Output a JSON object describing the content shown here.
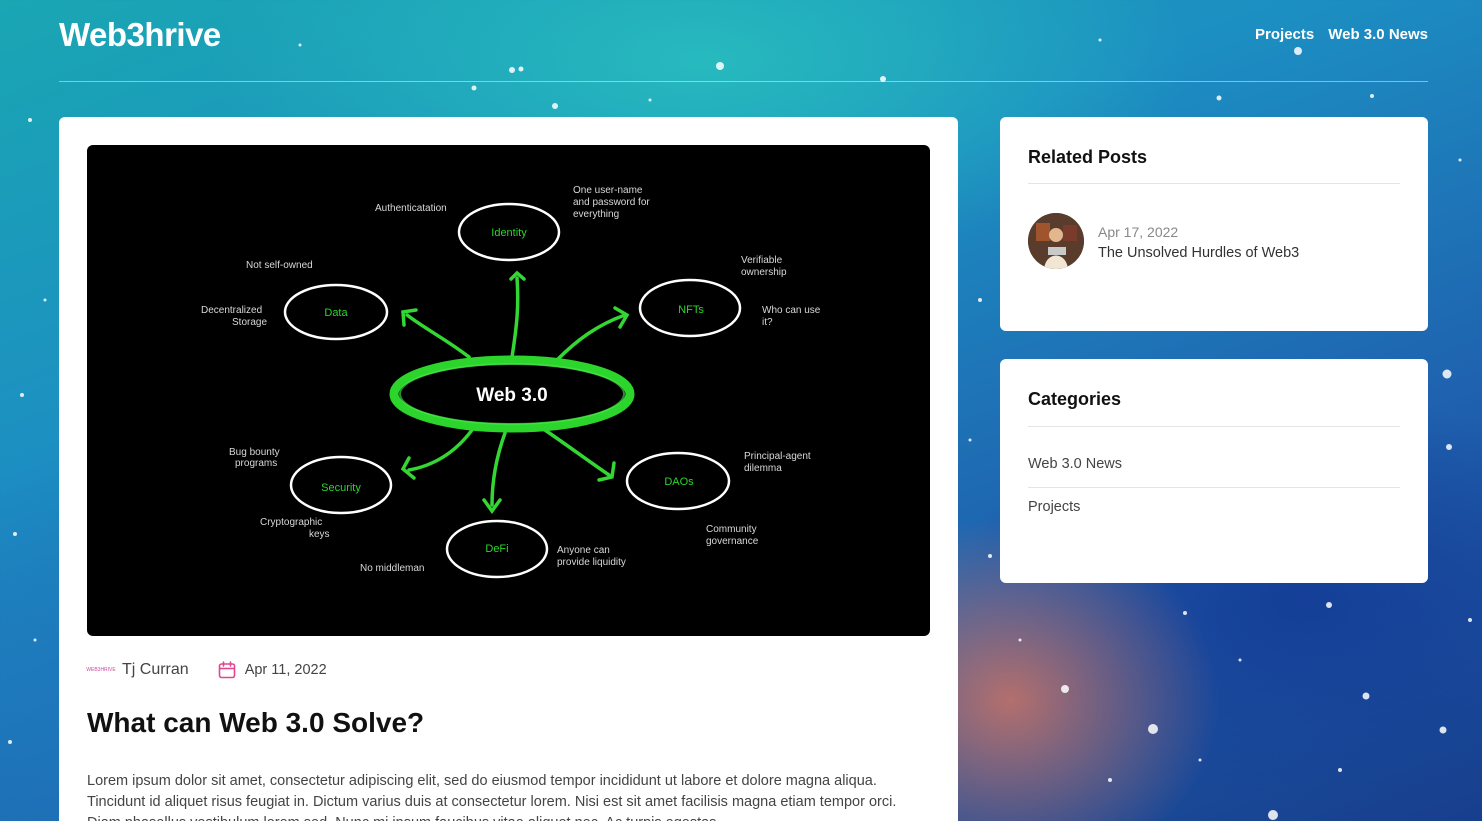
{
  "site": {
    "logo": "Web3hrive"
  },
  "nav": {
    "items": [
      {
        "label": "Projects"
      },
      {
        "label": "Web 3.0 News"
      }
    ]
  },
  "post": {
    "author": "Tj Curran",
    "author_avatar_text": "WEB3HRIVE",
    "date": "Apr 11, 2022",
    "title": "What can Web 3.0 Solve?",
    "body": "Lorem ipsum dolor sit amet, consectetur adipiscing elit, sed do eiusmod tempor incididunt ut labore et dolore magna aliqua. Tincidunt id aliquet risus feugiat in. Dictum varius duis at consectetur lorem. Nisi est sit amet facilisis magna etiam tempor orci. Diam phasellus vestibulum lorem sed. Nunc mi ipsum faucibus vitae aliquet nec. Ac turpis egestas"
  },
  "hero_diagram": {
    "center": "Web 3.0",
    "nodes": {
      "identity": "Identity",
      "nfts": "NFTs",
      "daos": "DAOs",
      "defi": "DeFi",
      "security": "Security",
      "data": "Data"
    },
    "notes": {
      "authentication": "Authenticatation",
      "one_user_1": "One user-name",
      "one_user_2": "and password for",
      "one_user_3": "everything",
      "not_self_owned": "Not self-owned",
      "decentralized_1": "Decentralized",
      "decentralized_2": "Storage",
      "verifiable_1": "Verifiable",
      "verifiable_2": "ownership",
      "who_can_use_1": "Who can use",
      "who_can_use_2": "it?",
      "bug_bounty_1": "Bug bounty",
      "bug_bounty_2": "programs",
      "crypto_keys_1": "Cryptographic",
      "crypto_keys_2": "keys",
      "principal_1": "Principal-agent",
      "principal_2": "dilemma",
      "community_1": "Community",
      "community_2": "governance",
      "anyone_1": "Anyone can",
      "anyone_2": "provide liquidity",
      "no_middleman": "No middleman"
    }
  },
  "related_posts": {
    "title": "Related Posts",
    "items": [
      {
        "date": "Apr 17, 2022",
        "title": "The Unsolved Hurdles of Web3"
      }
    ]
  },
  "categories": {
    "title": "Categories",
    "items": [
      {
        "label": "Web 3.0 News"
      },
      {
        "label": "Projects"
      }
    ]
  },
  "colors": {
    "accent_green": "#2bd52b",
    "calendar_pink": "#e0478f",
    "card_bg": "#ffffff"
  }
}
